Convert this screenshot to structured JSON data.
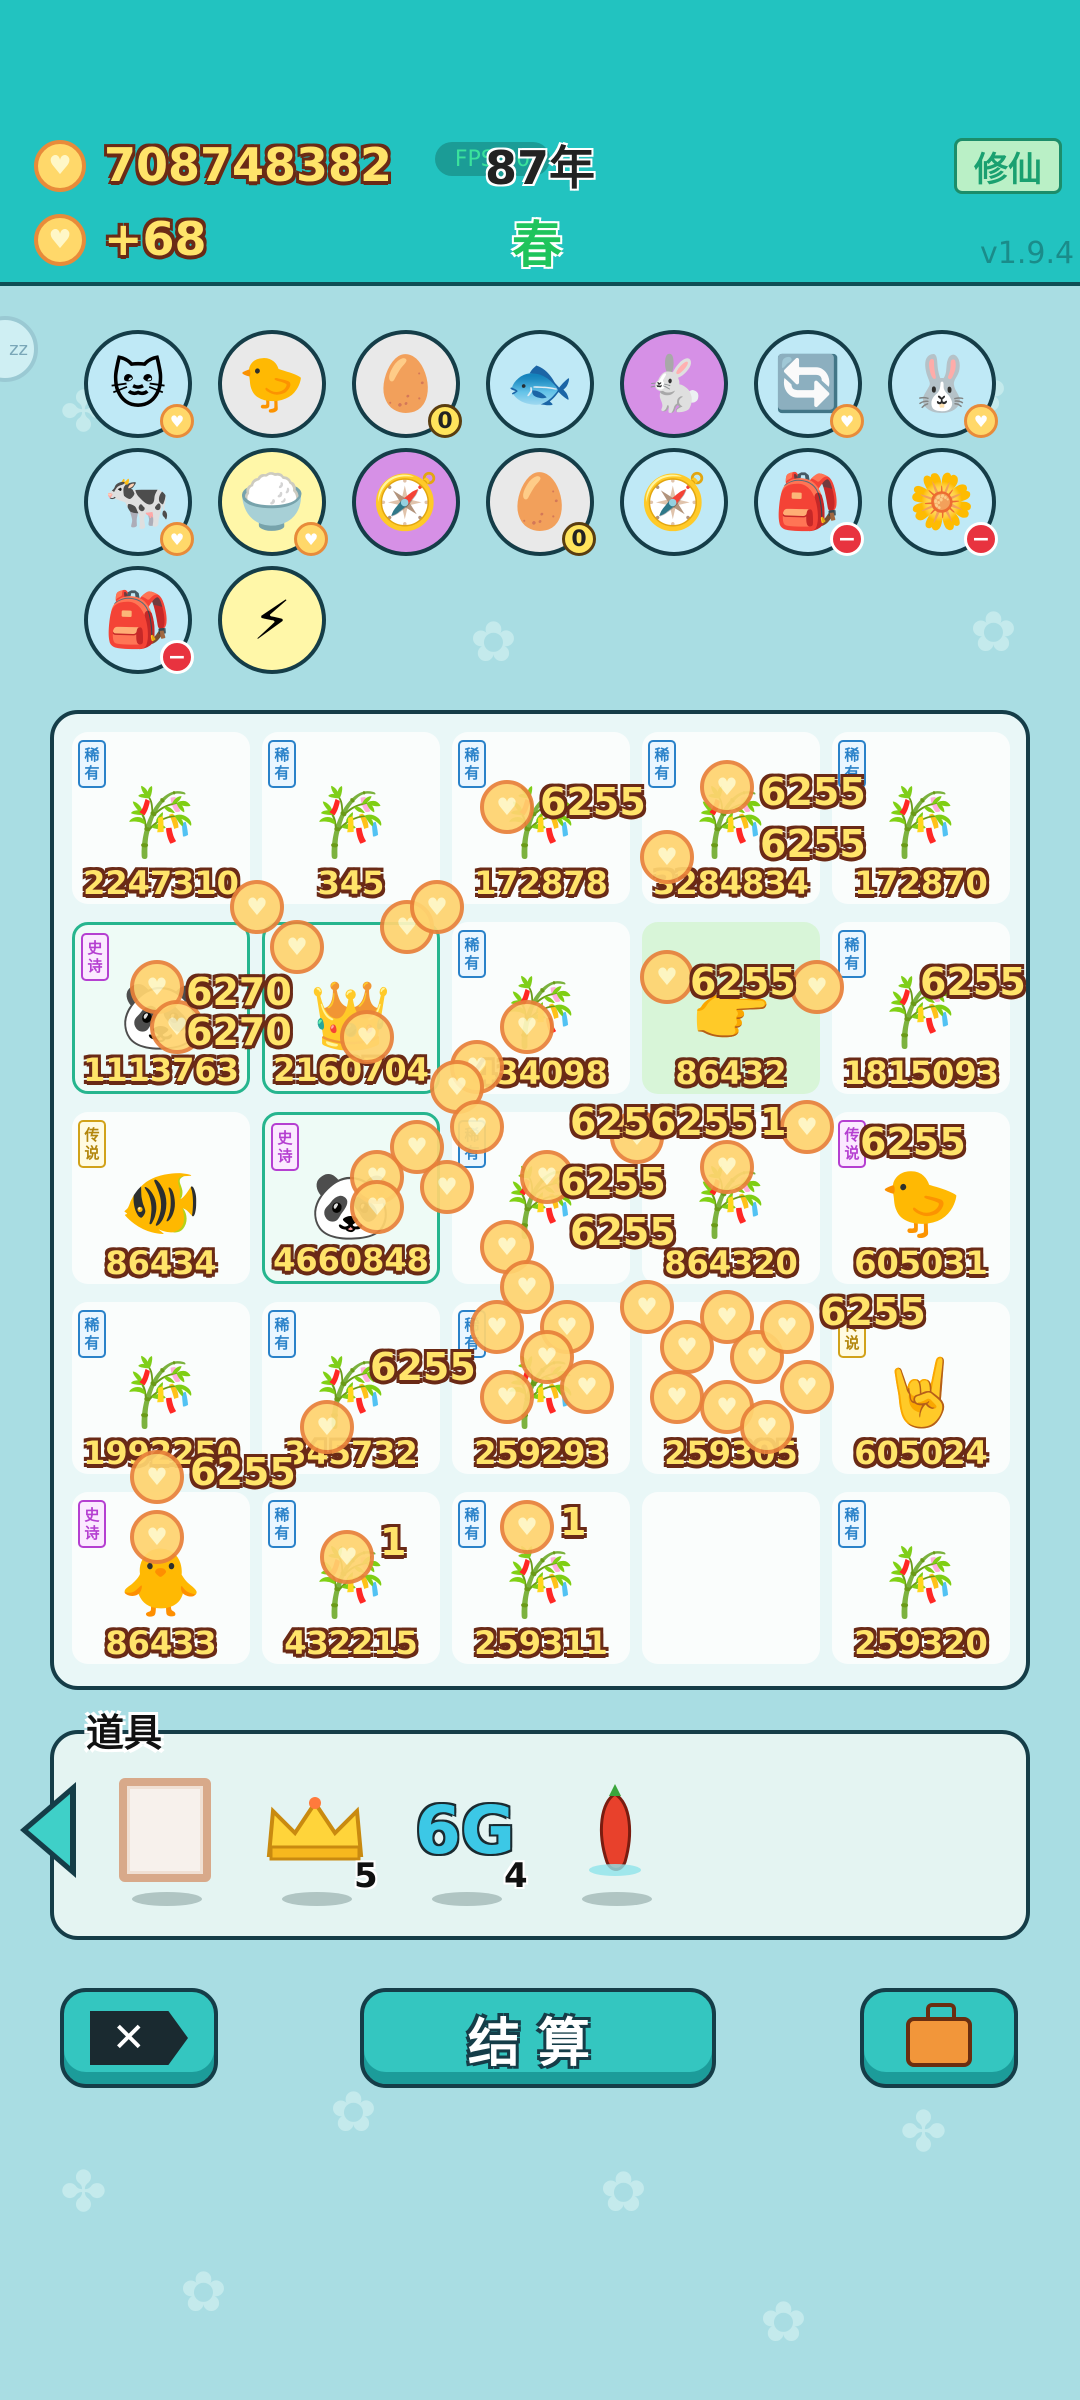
{
  "header": {
    "gold_amount": "708748382",
    "gold_rate": "+68",
    "fps_label": "FPS:60",
    "year": "87年",
    "season": "春",
    "cultivate_button": "修仙",
    "version": "v1.9.4"
  },
  "side_badge": "zz",
  "buffs": [
    {
      "name": "cat-icon",
      "glyph": "🐱",
      "bg": "#bfe9f6",
      "badge": "coin"
    },
    {
      "name": "chick-egg-icon",
      "glyph": "🐤",
      "bg": "#e9e9e9",
      "badge": ""
    },
    {
      "name": "egg-tray-icon",
      "glyph": "🥚",
      "bg": "#e9e9e9",
      "badge": "0"
    },
    {
      "name": "fishbowl-icon",
      "glyph": "🐟",
      "bg": "#bfe9f6",
      "badge": ""
    },
    {
      "name": "bunny-poster-icon",
      "glyph": "🐇",
      "bg": "#d690e6",
      "badge": ""
    },
    {
      "name": "refresh-icon",
      "glyph": "🔄",
      "bg": "#bfe9f6",
      "badge": "coin"
    },
    {
      "name": "rabbit-icon",
      "glyph": "🐰",
      "bg": "#bfe9f6",
      "badge": "coin"
    },
    {
      "name": "cows-icon",
      "glyph": "🐄",
      "bg": "#bfe9f6",
      "badge": "coin"
    },
    {
      "name": "rice-bowl-icon",
      "glyph": "🍚",
      "bg": "#fff7a8",
      "badge": "coin"
    },
    {
      "name": "compass-purple-icon",
      "glyph": "🧭",
      "bg": "#d690e6",
      "badge": ""
    },
    {
      "name": "egg-tray-icon",
      "glyph": "🥚",
      "bg": "#e9e9e9",
      "badge": "0"
    },
    {
      "name": "compass-icon",
      "glyph": "🧭",
      "bg": "#bfe9f6",
      "badge": ""
    },
    {
      "name": "seed-bag-icon",
      "glyph": "🎒",
      "bg": "#bfe9f6",
      "badge": "−"
    },
    {
      "name": "flower-pot-icon",
      "glyph": "🌼",
      "bg": "#bfe9f6",
      "badge": "−"
    },
    {
      "name": "seed-bag-icon",
      "glyph": "🎒",
      "bg": "#bfe9f6",
      "badge": "−"
    },
    {
      "name": "lightning-icon",
      "glyph": "⚡",
      "bg": "#fff7a8",
      "badge": ""
    }
  ],
  "board": {
    "cells": [
      {
        "tier": "稀有",
        "tier_type": "rare",
        "art": "🎋",
        "value": "2247310"
      },
      {
        "tier": "稀有",
        "tier_type": "rare",
        "art": "🎋",
        "value": "345"
      },
      {
        "tier": "稀有",
        "tier_type": "rare",
        "art": "🎋",
        "value": "172878"
      },
      {
        "tier": "稀有",
        "tier_type": "rare",
        "art": "🎋",
        "value": "3284834"
      },
      {
        "tier": "稀有",
        "tier_type": "rare",
        "art": "🎋",
        "value": "172870"
      },
      {
        "tier": "史诗",
        "tier_type": "epic",
        "art": "🐼",
        "value": "1113763",
        "style": "active"
      },
      {
        "tier": "",
        "tier_type": "",
        "art": "👑",
        "value": "2160704",
        "style": "active"
      },
      {
        "tier": "稀有",
        "tier_type": "rare",
        "art": "🎋",
        "value": "434098"
      },
      {
        "tier": "",
        "tier_type": "",
        "art": "👉",
        "value": "86432",
        "style": "glow"
      },
      {
        "tier": "稀有",
        "tier_type": "rare",
        "art": "🎋",
        "value": "1815093"
      },
      {
        "tier": "传说",
        "tier_type": "legend",
        "art": "🐠",
        "value": "86434"
      },
      {
        "tier": "史诗",
        "tier_type": "epic",
        "art": "🐼",
        "value": "4660848",
        "style": "active"
      },
      {
        "tier": "稀有",
        "tier_type": "rare",
        "art": "🎋",
        "value": ""
      },
      {
        "tier": "",
        "tier_type": "",
        "art": "🎋",
        "value": "864320"
      },
      {
        "tier": "传说",
        "tier_type": "epic",
        "art": "🐤",
        "value": "605031"
      },
      {
        "tier": "稀有",
        "tier_type": "rare",
        "art": "🎋",
        "value": "1992250"
      },
      {
        "tier": "稀有",
        "tier_type": "rare",
        "art": "🎋",
        "value": "345732"
      },
      {
        "tier": "稀有",
        "tier_type": "rare",
        "art": "🎋",
        "value": "259293"
      },
      {
        "tier": "",
        "tier_type": "",
        "art": "",
        "value": "259305"
      },
      {
        "tier": "传说",
        "tier_type": "legend",
        "art": "🤘",
        "value": "605024"
      },
      {
        "tier": "史诗",
        "tier_type": "epic",
        "art": "🐥",
        "value": "86433"
      },
      {
        "tier": "稀有",
        "tier_type": "rare",
        "art": "🎋",
        "value": "432215"
      },
      {
        "tier": "稀有",
        "tier_type": "rare",
        "art": "🎋",
        "value": "259311"
      },
      {
        "tier": "",
        "tier_type": "",
        "art": "",
        "value": ""
      },
      {
        "tier": "稀有",
        "tier_type": "rare",
        "art": "🎋",
        "value": "259320"
      }
    ],
    "floating_values": [
      "6255",
      "6255",
      "6255",
      "6270",
      "6270",
      "6255",
      "6255",
      "6255",
      "6255",
      "6255",
      "6255",
      "6255",
      "6255",
      "6255",
      "6255",
      "1",
      "1",
      "1"
    ]
  },
  "items": {
    "title": "道具",
    "list": [
      {
        "name": "blank-card-icon",
        "count": ""
      },
      {
        "name": "crown-icon",
        "count": "5"
      },
      {
        "name": "6g-icon",
        "label": "6G",
        "count": "4"
      },
      {
        "name": "chili-pepper-icon",
        "count": ""
      }
    ]
  },
  "buttons": {
    "delete": "✕",
    "settle": "结算"
  },
  "colors": {
    "header_bg": "#22c3c0",
    "page_bg": "#a9dde3",
    "outline": "#153d48",
    "gold_text": "#ffe46a"
  }
}
